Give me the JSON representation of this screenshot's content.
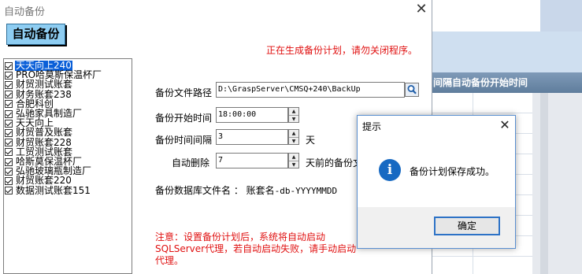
{
  "window": {
    "title": "自动备份",
    "close_glyph": "✕"
  },
  "auto_button": "自动备份",
  "status_message": "正在生成备份计划，请勿关闭程序。",
  "accounts": [
    {
      "label": "天天向上240",
      "checked": true,
      "selected": true
    },
    {
      "label": "PRO哈莫斯保温杯厂",
      "checked": true,
      "selected": false
    },
    {
      "label": "财贸测试账套",
      "checked": true,
      "selected": false
    },
    {
      "label": "财务账套238",
      "checked": true,
      "selected": false
    },
    {
      "label": "合肥科创",
      "checked": true,
      "selected": false
    },
    {
      "label": "弘驰家具制造厂",
      "checked": true,
      "selected": false
    },
    {
      "label": "天天向上",
      "checked": true,
      "selected": false
    },
    {
      "label": "财贸普及账套",
      "checked": true,
      "selected": false
    },
    {
      "label": "财贸账套228",
      "checked": true,
      "selected": false
    },
    {
      "label": "工贸测试账套",
      "checked": true,
      "selected": false
    },
    {
      "label": "哈斯莫保温杯厂",
      "checked": true,
      "selected": false
    },
    {
      "label": "弘驰玻璃瓶制造厂",
      "checked": true,
      "selected": false
    },
    {
      "label": "财贸账套220",
      "checked": true,
      "selected": false
    },
    {
      "label": "数据测试账套151",
      "checked": true,
      "selected": false
    }
  ],
  "form": {
    "path_label": "备份文件路径",
    "path_value": "D:\\GraspServer\\CMSQ+240\\BackUp",
    "start_label": "备份开始时间",
    "start_value": "18:00:00",
    "interval_label": "备份时间间隔",
    "interval_value": "3",
    "interval_unit": "天",
    "autodelete_label": "自动删除",
    "autodelete_value": "7",
    "autodelete_unit": "天前的备份文",
    "dbname_label": "备份数据库文件名 ：",
    "dbname_prefix": "账套名",
    "dbname_pattern": "-db-YYYYMMDD",
    "note": "注意：设置备份计划后，系统将自动启动SQLServer代理，若自动启动失败，请手动启动代理。"
  },
  "background_app": {
    "column_header": "间隔自动备份开始时间"
  },
  "dialog": {
    "title": "提示",
    "message": "备份计划保存成功。",
    "ok_label": "确定",
    "icon_glyph": "i"
  }
}
